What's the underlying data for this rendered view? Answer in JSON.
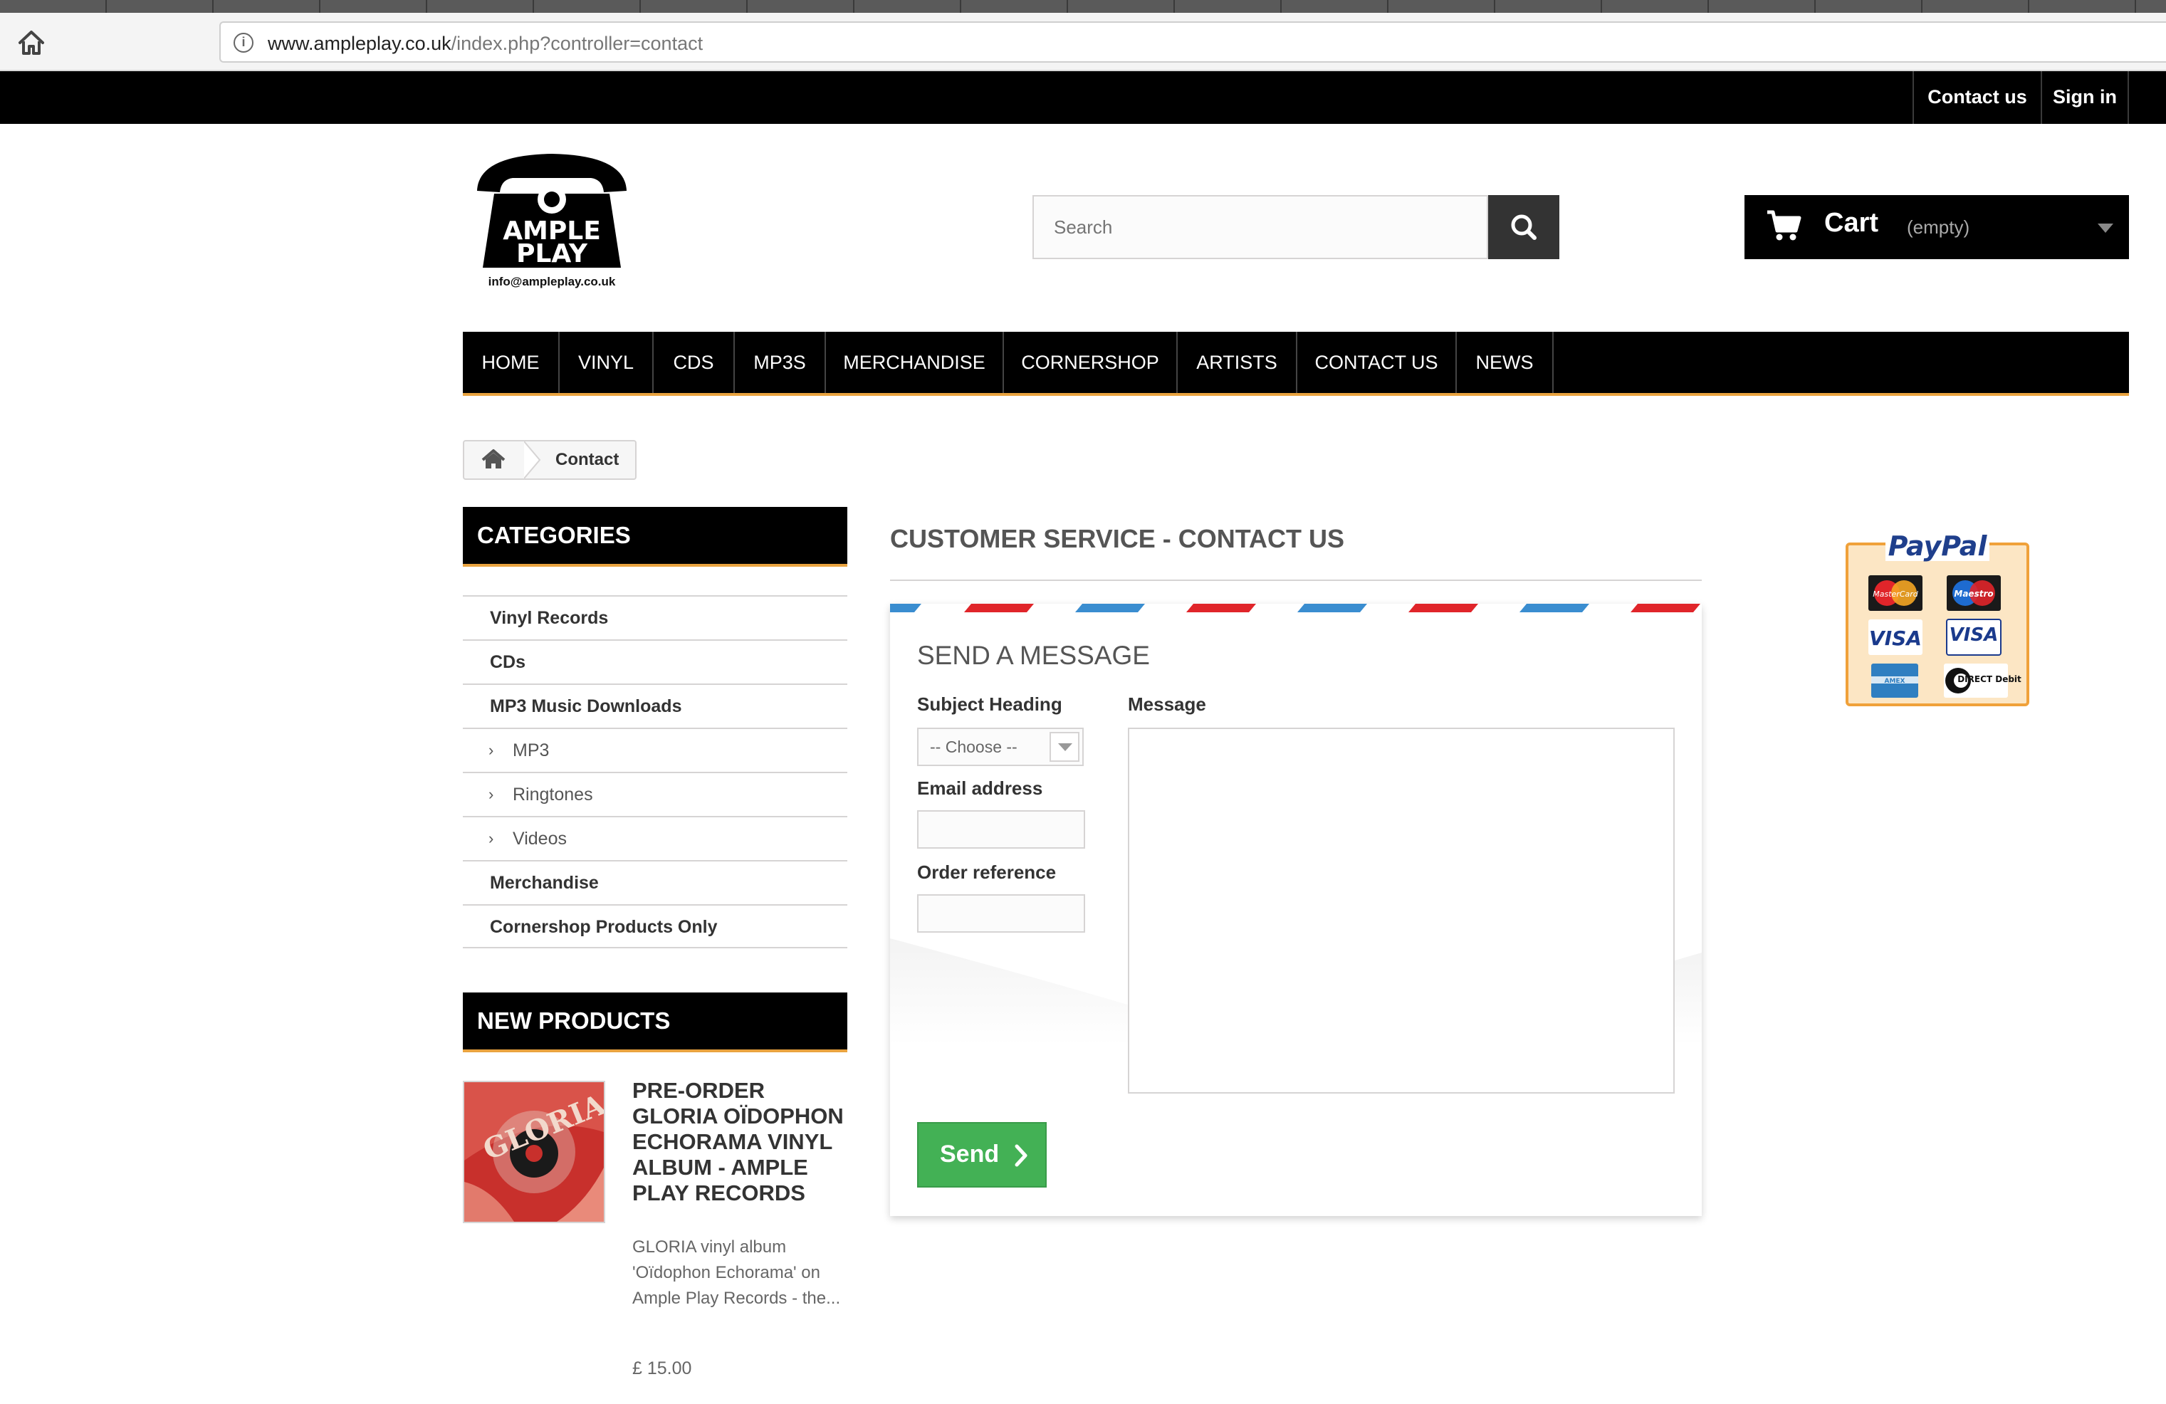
{
  "browser": {
    "url_host": "www.ampleplay.co.uk",
    "url_path": "/index.php?controller=contact",
    "info_icon": "info-icon",
    "home_icon": "home-icon"
  },
  "topnav": {
    "contact_label": "Contact us",
    "signin_label": "Sign in"
  },
  "header": {
    "logo_line1": "AMPLE",
    "logo_line2": "PLAY",
    "logo_email": "info@ampleplay.co.uk",
    "search_placeholder": "Search",
    "search_icon": "magnifier-icon",
    "cart_label": "Cart",
    "cart_status": "(empty)",
    "cart_icon": "shopping-cart-icon"
  },
  "menu": [
    {
      "label": "HOME"
    },
    {
      "label": "VINYL"
    },
    {
      "label": "CDS"
    },
    {
      "label": "MP3S"
    },
    {
      "label": "MERCHANDISE"
    },
    {
      "label": "CORNERSHOP"
    },
    {
      "label": "ARTISTS"
    },
    {
      "label": "CONTACT US"
    },
    {
      "label": "NEWS"
    }
  ],
  "breadcrumb": {
    "home_icon": "home-icon",
    "current": "Contact"
  },
  "categories": {
    "title": "CATEGORIES",
    "items": [
      {
        "label": "Vinyl Records"
      },
      {
        "label": "CDs"
      },
      {
        "label": "MP3 Music Downloads"
      },
      {
        "label": "MP3"
      },
      {
        "label": "Ringtones"
      },
      {
        "label": "Videos"
      },
      {
        "label": "Merchandise"
      },
      {
        "label": "Cornershop Products Only"
      }
    ]
  },
  "new_products": {
    "title": "NEW PRODUCTS",
    "product": {
      "title": "PRE-ORDER GLORIA OÏDOPHON ECHORAMA VINYL ALBUM - AMPLE PLAY RECORDS",
      "description": "GLORIA vinyl album 'Oïdophon Echorama' on Ample Play Records - the...",
      "price": "£ 15.00",
      "image_word": "GLORIA"
    }
  },
  "contact": {
    "page_heading": "CUSTOMER SERVICE - CONTACT US",
    "form_heading": "SEND A MESSAGE",
    "subject_label": "Subject Heading",
    "subject_value": "-- Choose --",
    "email_label": "Email address",
    "email_value": "",
    "order_label": "Order reference",
    "order_value": "",
    "message_label": "Message",
    "message_value": "",
    "send_label": "Send"
  },
  "payments": {
    "brand": "PayPal",
    "cards": [
      {
        "label": "MasterCard"
      },
      {
        "label": "Maestro"
      },
      {
        "label": "VISA"
      },
      {
        "label": "VISA"
      },
      {
        "label": "AMEX"
      },
      {
        "label": "DIRECT Debit"
      }
    ]
  },
  "colors": {
    "accent_orange": "#e9a33f",
    "send_green": "#43b155",
    "airmail_red": "#e0252a",
    "airmail_blue": "#3a8dd0",
    "bar_black": "#000000"
  }
}
